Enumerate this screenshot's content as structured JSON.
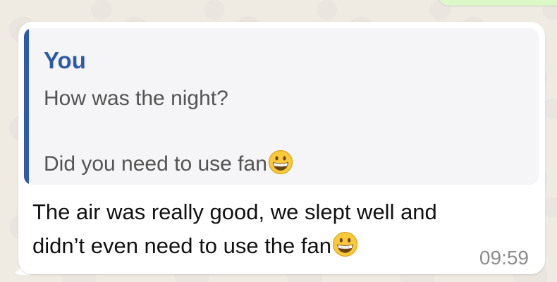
{
  "conversation": {
    "quoted_message": {
      "author": "You",
      "line_1": "How was the night?",
      "line_2": "Did you need to use fan",
      "line_2_emoji": "grinning-face-emoji"
    },
    "message": {
      "line_1": "The air was really good, we slept well and",
      "line_2": "didn’t even need to use the fan",
      "line_2_emoji": "grinning-face-emoji",
      "timestamp": "09:59"
    }
  },
  "colors": {
    "background": "#efeae2",
    "bubble": "#ffffff",
    "quote_background": "#f5f4f6",
    "quote_accent": "#2c5aa8",
    "outgoing_bubble": "#dcf8c6",
    "timestamp": "#8c8c8c"
  }
}
